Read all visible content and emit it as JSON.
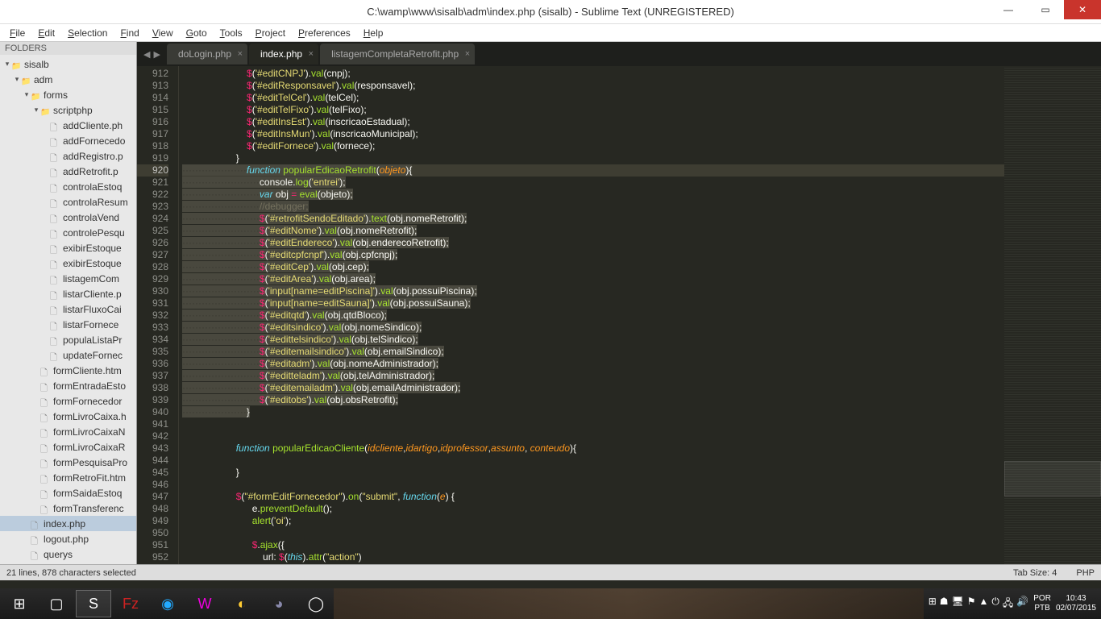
{
  "window": {
    "title": "C:\\wamp\\www\\sisalb\\adm\\index.php (sisalb) - Sublime Text (UNREGISTERED)"
  },
  "menu": [
    "File",
    "Edit",
    "Selection",
    "Find",
    "View",
    "Goto",
    "Tools",
    "Project",
    "Preferences",
    "Help"
  ],
  "sidebar": {
    "header": "FOLDERS",
    "l0": "sisalb",
    "l1": "adm",
    "l2": "forms",
    "l3": "scriptphp",
    "scriptphp_files": [
      "addCliente.ph",
      "addFornecedo",
      "addRegistro.p",
      "addRetrofit.p",
      "controlaEstoq",
      "controlaResum",
      "controlaVend",
      "controlePesqu",
      "exibirEstoque",
      "exibirEstoque",
      "listagemCom",
      "listarCliente.p",
      "listarFluxoCai",
      "listarFornece",
      "populaListaPr",
      "updateFornec"
    ],
    "forms_files": [
      "formCliente.htm",
      "formEntradaEsto",
      "formFornecedor",
      "formLivroCaixa.h",
      "formLivroCaixaN",
      "formLivroCaixaR",
      "formPesquisaPro",
      "formRetroFit.htm",
      "formSaidaEstoq",
      "formTransferenc"
    ],
    "adm_files": [
      "index.php",
      "logout.php",
      "querys"
    ],
    "adm_sel": 0
  },
  "tabs": [
    {
      "label": "doLogin.php",
      "active": false
    },
    {
      "label": "index.php",
      "active": true
    },
    {
      "label": "listagemCompletaRetrofit.php",
      "active": false
    }
  ],
  "gutter": {
    "start": 912,
    "end": 952,
    "highlight": 920
  },
  "code": {
    "912": "$('#editCNPJ').val(cnpj);",
    "913": "$('#editResponsavel').val(responsavel);",
    "914": "$('#editTelCel').val(telCel);",
    "915": "$('#editTelFixo').val(telFixo);",
    "916": "$('#editInsEst').val(inscricaoEstadual);",
    "917": "$('#editInsMun').val(inscricaoMunicipal);",
    "918": "$('#editFornece').val(fornece);",
    "919": "}",
    "920": "function popularEdicaoRetrofit(objeto){",
    "921": "console.log('entrei');",
    "922": "var obj = eval(objeto);",
    "923": "//debugger;",
    "924": "$('#retrofitSendoEditado').text(obj.nomeRetrofit);",
    "925": "$('#editNome').val(obj.nomeRetrofit);",
    "926": "$('#editEndereco').val(obj.enderecoRetrofit);",
    "927": "$('#editcpfcnpf').val(obj.cpfcnpj);",
    "928": "$('#editCep').val(obj.cep);",
    "929": "$('#editArea').val(obj.area);",
    "930": "$('input[name=editPiscina]').val(obj.possuiPiscina);",
    "931": "$('input[name=editSauna]').val(obj.possuiSauna);",
    "932": "$('#editqtd').val(obj.qtdBloco);",
    "933": "$('#editsindico').val(obj.nomeSindico);",
    "934": "$('#edittelsindico').val(obj.telSindico);",
    "935": "$('#editemailsindico').val(obj.emailSindico);",
    "936": "$('#editadm').val(obj.nomeAdministrador);",
    "937": "$('#editteladm').val(obj.telAdministrador);",
    "938": "$('#editemailadm').val(obj.emailAdministrador);",
    "939": "$('#editobs').val(obj.obsRetrofit);",
    "940": "}",
    "943_fn": "function popularEdicaoCliente(idcliente,idartigo,idprofessor,assunto, conteudo){",
    "947": "$(\"#formEditFornecedor\").on(\"submit\", function(e) {",
    "948": "e.preventDefault();",
    "949": "alert('oi');",
    "951": "$.ajax({",
    "952": "url: $(this).attr(\"action\")"
  },
  "status": {
    "left": "21 lines, 878 characters selected",
    "tab": "Tab Size: 4",
    "lang": "PHP"
  },
  "tray": {
    "lang1": "POR",
    "lang2": "PTB",
    "time": "10:43",
    "date": "02/07/2015"
  }
}
